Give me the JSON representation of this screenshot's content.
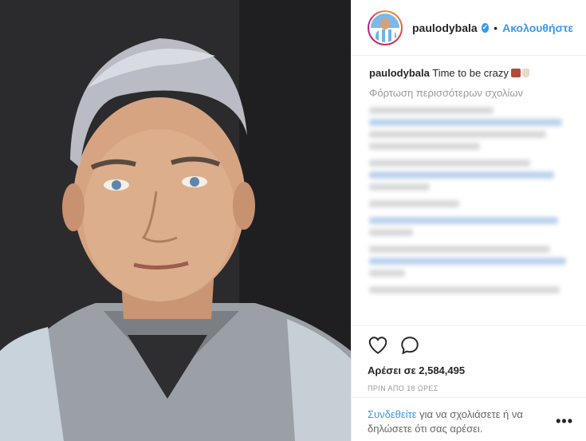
{
  "post": {
    "username": "paulodybala",
    "follow_label": "Ακολουθήστε",
    "caption_user": "paulodybala",
    "caption_text": "Time to be crazy",
    "load_more_label": "Φόρτωση περισσότερων σχολίων",
    "likes_text": "Αρέσει σε 2,584,495",
    "timestamp": "ΠΡΙΝ ΑΠΟ 18 ΩΡΕΣ",
    "login_link": "Συνδεθείτε",
    "login_text": "για να σχολιάσετε ή να δηλώσετε ότι σας αρέσει."
  },
  "icons": {
    "verified": "verified-badge-icon",
    "like": "heart-icon",
    "comment": "comment-bubble-icon",
    "more": "more-options-icon"
  },
  "colors": {
    "accent": "#3897f0",
    "text": "#262626",
    "muted": "#999999",
    "border": "#efefef"
  }
}
